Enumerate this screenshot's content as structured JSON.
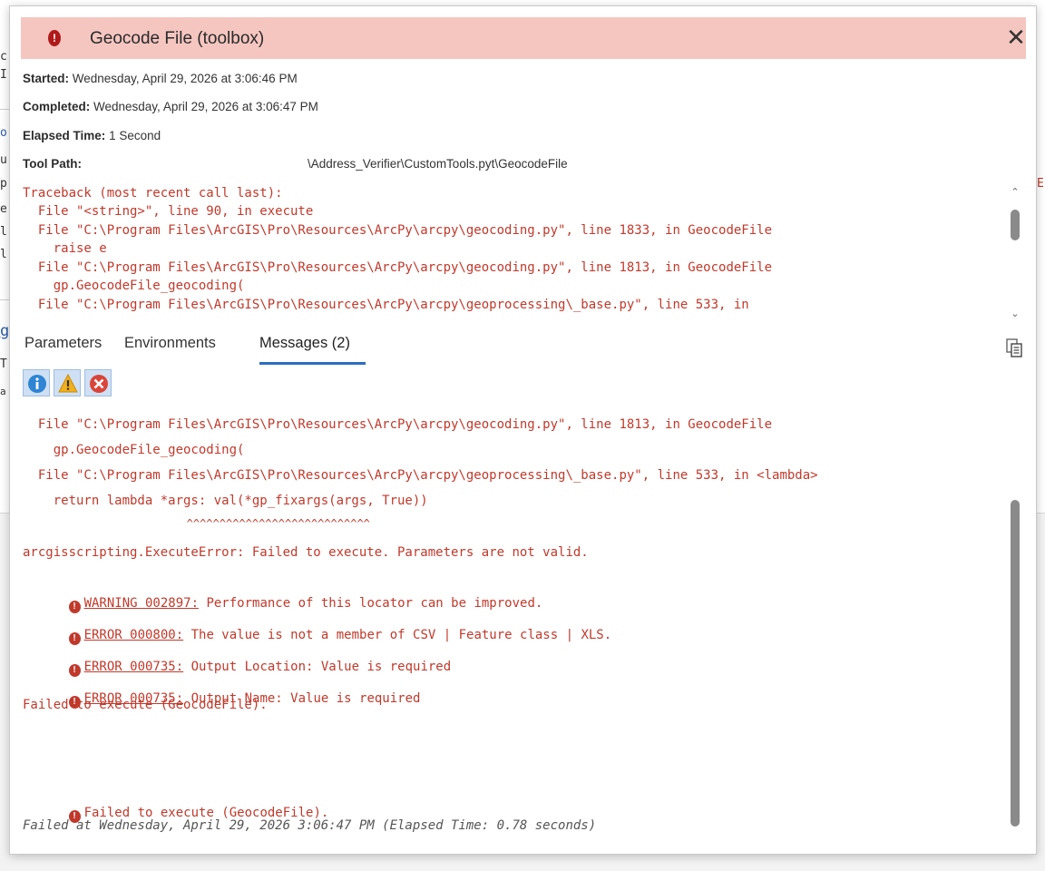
{
  "background": {
    "fragments": [
      "c",
      "I",
      "o",
      "u",
      "p",
      "e",
      "l",
      "l",
      "g",
      "T",
      "a"
    ],
    "edge_right": "E"
  },
  "dialog": {
    "title": "Geocode File (toolbox)",
    "close_symbol": "✕",
    "started_label": "Started:",
    "started_value": "Wednesday, April 29, 2026 at 3:06:46 PM",
    "completed_label": "Completed:",
    "completed_value": "Wednesday, April 29, 2026 at 3:06:47 PM",
    "elapsed_label": "Elapsed Time:",
    "elapsed_value": "1 Second",
    "toolpath_label": "Tool Path:",
    "toolpath_value": "\\Address_Verifier\\CustomTools.pyt\\GeocodeFile"
  },
  "traceback": [
    "Traceback (most recent call last):",
    "  File \"<string>\", line 90, in execute",
    "  File \"C:\\Program Files\\ArcGIS\\Pro\\Resources\\ArcPy\\arcpy\\geocoding.py\", line 1833, in GeocodeFile",
    "    raise e",
    "  File \"C:\\Program Files\\ArcGIS\\Pro\\Resources\\ArcPy\\arcpy\\geocoding.py\", line 1813, in GeocodeFile",
    "    gp.GeocodeFile_geocoding(",
    "  File \"C:\\Program Files\\ArcGIS\\Pro\\Resources\\ArcPy\\arcpy\\geoprocessing\\_base.py\", line 533, in"
  ],
  "tabs": [
    {
      "label": "Parameters"
    },
    {
      "label": "Environments"
    },
    {
      "label": "Messages (2)"
    }
  ],
  "filters": [
    {
      "name": "info",
      "color": "#2f84d3"
    },
    {
      "name": "warning",
      "color": "#f2b01e"
    },
    {
      "name": "error",
      "color": "#d9453a"
    }
  ],
  "messages": {
    "lines": [
      "  File \"C:\\Program Files\\ArcGIS\\Pro\\Resources\\ArcPy\\arcpy\\geocoding.py\", line 1813, in GeocodeFile",
      "    gp.GeocodeFile_geocoding(",
      "  File \"C:\\Program Files\\ArcGIS\\Pro\\Resources\\ArcPy\\arcpy\\geoprocessing\\_base.py\", line 533, in <lambda>",
      "    return lambda *args: val(*gp_fixargs(args, True))",
      "                         ^^^^^^^^^^^^^^^^^^^^^^^^^^^^",
      "arcgisscripting.ExecuteError: Failed to execute. Parameters are not valid."
    ],
    "coded": [
      {
        "code": "WARNING 002897:",
        "text": " Performance of this locator can be improved."
      },
      {
        "code": "ERROR 000800:",
        "text": " The value is not a member of CSV | Feature class | XLS."
      },
      {
        "code": "ERROR 000735:",
        "text": " Output Location: Value is required"
      },
      {
        "code": "ERROR 000735:",
        "text": " Output Name: Value is required"
      }
    ],
    "failed_inline": "Failed to execute (GeocodeFile).",
    "failed_final": "Failed to execute (GeocodeFile).",
    "footer": "Failed at Wednesday, April 29, 2026 3:06:47 PM (Elapsed Time: 0.78 seconds)"
  },
  "colors": {
    "header_bg": "#f5c6c0",
    "error_text": "#c0392b",
    "tab_underline": "#2b6ec2"
  }
}
